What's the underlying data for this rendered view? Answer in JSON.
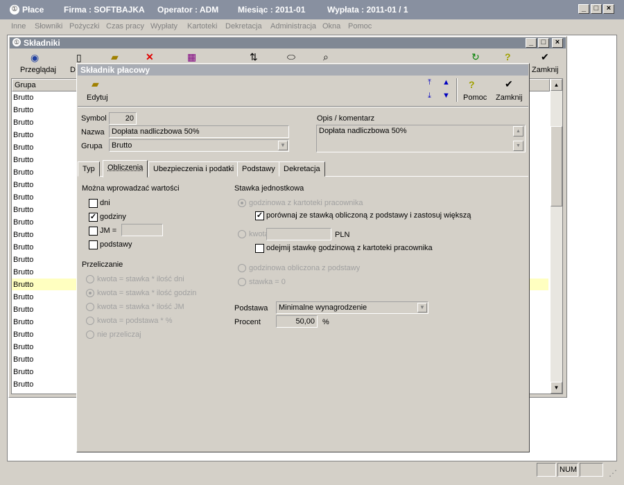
{
  "main_title": {
    "app": "Płace",
    "firma": "Firma : SOFTBAJKA",
    "operator": "Operator : ADM",
    "miesiac": "Miesiąc : 2011-01",
    "wyplata": "Wypłata : 2011-01 /  1"
  },
  "menu": [
    "Inne",
    "Słowniki",
    "Pożyczki",
    "Czas pracy",
    "Wypłaty",
    "Kartoteki",
    "Dekretacja",
    "Administracja",
    "Okna",
    "Pomoc"
  ],
  "skladniki": {
    "title": "Składniki",
    "toolbar": {
      "przegladaj": "Przeglądaj",
      "d": "D",
      "zamknij": "Zamknij"
    },
    "column_header": "Grupa",
    "rows": [
      "Brutto",
      "Brutto",
      "Brutto",
      "Brutto",
      "Brutto",
      "Brutto",
      "Brutto",
      "Brutto",
      "Brutto",
      "Brutto",
      "Brutto",
      "Brutto",
      "Brutto",
      "Brutto",
      "Brutto",
      "Brutto",
      "Brutto",
      "Brutto",
      "Brutto",
      "Brutto",
      "Brutto",
      "Brutto",
      "Brutto",
      "Brutto"
    ],
    "highlight_row_color": "#ffffc0"
  },
  "dialog": {
    "title": "Składnik płacowy",
    "toolbar": {
      "edytuj": "Edytuj",
      "pomoc": "Pomoc",
      "zamknij": "Zamknij"
    },
    "symbol_label": "Symbol",
    "symbol_value": "20",
    "nazwa_label": "Nazwa",
    "nazwa_value": "Dopłata nadliczbowa 50%",
    "grupa_label": "Grupa",
    "grupa_value": "Brutto",
    "opis_label": "Opis / komentarz",
    "opis_value": "Dopłata nadliczbowa 50%",
    "tabs": [
      "Typ",
      "Obliczenia",
      "Ubezpieczenia i podatki",
      "Podstawy",
      "Dekretacja"
    ],
    "active_tab": "Obliczenia",
    "wprowadzac": {
      "label": "Można wprowadzać wartości",
      "dni": "dni",
      "dni_checked": false,
      "godziny": "godziny",
      "godziny_checked": true,
      "jm": "JM =",
      "jm_checked": false,
      "jm_value": "",
      "podstawy": "podstawy",
      "podstawy_checked": false
    },
    "przeliczanie": {
      "label": "Przeliczanie",
      "options": [
        "kwota = stawka * ilość dni",
        "kwota = stawka * ilość godzin",
        "kwota = stawka * ilość JM",
        "kwota = podstawa * %",
        "nie przeliczaj"
      ],
      "selected": "kwota = stawka * ilość godzin"
    },
    "stawka": {
      "label": "Stawka jednostkowa",
      "opt1": "godzinowa z kartoteki pracownika",
      "porownaj": "porównaj ze stawką obliczoną z podstawy i zastosuj większą",
      "porownaj_checked": true,
      "kwota": "kwota",
      "kwota_value": "",
      "pln": "PLN",
      "odejmij": "odejmij stawkę godzinową z kartoteki pracownika",
      "odejmij_checked": false,
      "opt3": "godzinowa obliczona z podstawy",
      "opt4": "stawka = 0"
    },
    "podstawa_label": "Podstawa",
    "podstawa_value": "Minimalne wynagrodzenie",
    "procent_label": "Procent",
    "procent_value": "50,00",
    "procent_unit": "%"
  },
  "statusbar": {
    "num": "NUM"
  }
}
